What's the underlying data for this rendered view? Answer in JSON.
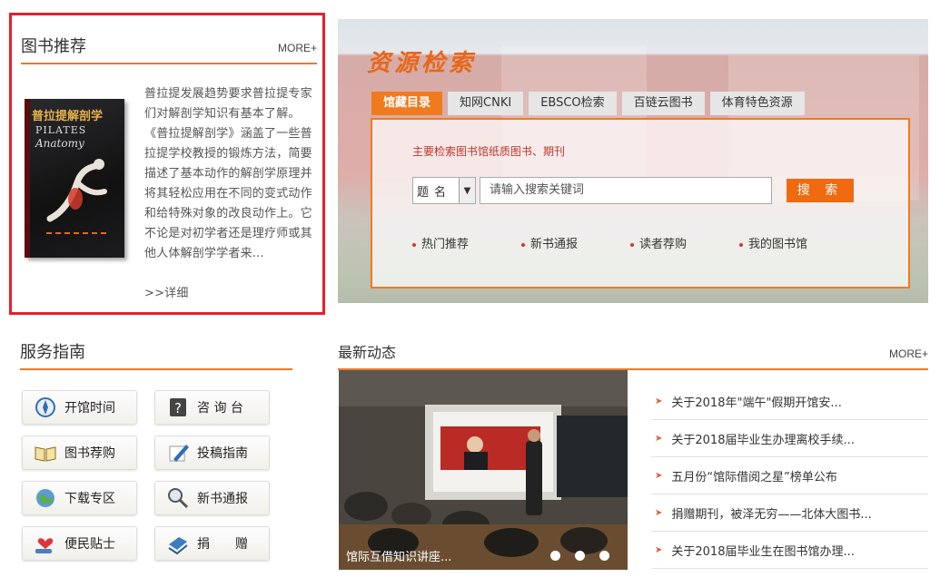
{
  "book_recommend": {
    "title": "图书推荐",
    "more": "MORE+",
    "cover_title": "普拉提解剖学",
    "cover_en_1": "PILATES",
    "cover_en_2": "Anatomy",
    "description": "普拉提发展趋势要求普拉提专家们对解剖学知识有基本了解。《普拉提解剖学》涵盖了一些普拉提学校教授的锻炼方法，简要描述了基本动作的解剖学原理并将其轻松应用在不同的变式动作和给特殊对象的改良动作上。它不论是对初学者还是理疗师或其他人体解剖学学者来...",
    "detail_link": ">>详细"
  },
  "search": {
    "heading": "资源检索",
    "tabs": [
      "馆藏目录",
      "知网CNKI",
      "EBSCO检索",
      "百链云图书",
      "体育特色资源"
    ],
    "active_tab": "馆藏目录",
    "hint": "主要检索图书馆纸质图书、期刊",
    "field_select": "题名",
    "input_placeholder": "请输入搜索关键词",
    "button": "搜 索",
    "quick_links": [
      "热门推荐",
      "新书通报",
      "读者荐购",
      "我的图书馆"
    ]
  },
  "service": {
    "title": "服务指南",
    "buttons": [
      {
        "label": "开馆时间",
        "icon": "compass-icon"
      },
      {
        "label": "咨 询 台",
        "icon": "question-icon"
      },
      {
        "label": "图书荐购",
        "icon": "open-book-icon"
      },
      {
        "label": "投稿指南",
        "icon": "pen-icon"
      },
      {
        "label": "下载专区",
        "icon": "globe-icon"
      },
      {
        "label": "新书通报",
        "icon": "magnifier-icon"
      },
      {
        "label": "便民贴士",
        "icon": "heart-hand-icon"
      },
      {
        "label": "捐　　赠",
        "icon": "donate-icon"
      }
    ]
  },
  "news": {
    "title": "最新动态",
    "more": "MORE+",
    "slide_caption": "馆际互借知识讲座...",
    "slide_count": 3,
    "items": [
      "关于2018年\"端午\"假期开馆安...",
      "关于2018届毕业生办理离校手续...",
      "五月份“馆际借阅之星”榜单公布",
      "捐赠期刊，被泽无穷——北体大图书...",
      "关于2018届毕业生在图书馆办理..."
    ]
  },
  "colors": {
    "accent": "#f07a1e",
    "highlight_border": "#e6202a",
    "hint_red": "#c0342a"
  }
}
